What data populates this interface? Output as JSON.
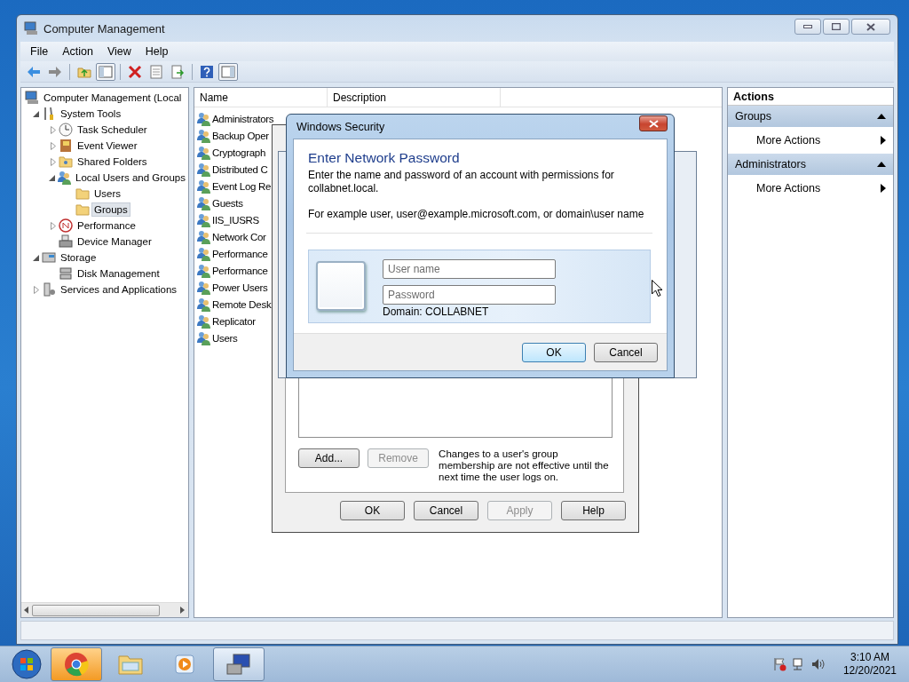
{
  "window": {
    "title": "Computer Management"
  },
  "menu": [
    "File",
    "Action",
    "View",
    "Help"
  ],
  "toolbar": [
    [
      {
        "kind": "back",
        "pressed": false
      },
      {
        "kind": "forward",
        "pressed": false
      }
    ],
    [
      {
        "kind": "up",
        "pressed": false
      },
      {
        "kind": "tree",
        "pressed": true
      }
    ],
    [
      {
        "kind": "delete",
        "pressed": false
      },
      {
        "kind": "properties",
        "pressed": false
      },
      {
        "kind": "export",
        "pressed": false
      }
    ],
    [
      {
        "kind": "help",
        "pressed": false
      },
      {
        "kind": "actionpane",
        "pressed": true
      }
    ]
  ],
  "tree": [
    {
      "label": "Computer Management (Local",
      "kind": "computer",
      "selected": false,
      "children": [
        {
          "label": "System Tools",
          "kind": "tools",
          "expanded": true,
          "selected": false,
          "children": [
            {
              "label": "Task Scheduler",
              "kind": "clock",
              "expanded": false,
              "selected": false
            },
            {
              "label": "Event Viewer",
              "kind": "log",
              "expanded": false,
              "selected": false
            },
            {
              "label": "Shared Folders",
              "kind": "share",
              "expanded": false,
              "selected": false
            },
            {
              "label": "Local Users and Groups",
              "kind": "users",
              "expanded": true,
              "selected": false,
              "children": [
                {
                  "label": "Users",
                  "kind": "folder",
                  "selected": false
                },
                {
                  "label": "Groups",
                  "kind": "folder",
                  "selected": true
                }
              ]
            },
            {
              "label": "Performance",
              "kind": "perf",
              "expanded": false,
              "selected": false
            },
            {
              "label": "Device Manager",
              "kind": "device",
              "selected": false
            }
          ]
        },
        {
          "label": "Storage",
          "kind": "storage",
          "expanded": true,
          "selected": false,
          "children": [
            {
              "label": "Disk Management",
              "kind": "disk",
              "selected": false
            }
          ]
        },
        {
          "label": "Services and Applications",
          "kind": "services",
          "expanded": false,
          "selected": false
        }
      ]
    }
  ],
  "list": {
    "columns": [
      "Name",
      "Description"
    ],
    "rows": [
      {
        "name": "Administrators",
        "selected": false
      },
      {
        "name": "Backup Oper",
        "selected": false
      },
      {
        "name": "Cryptograph",
        "selected": false
      },
      {
        "name": "Distributed C",
        "selected": false
      },
      {
        "name": "Event Log Re",
        "selected": false
      },
      {
        "name": "Guests",
        "selected": false
      },
      {
        "name": "IIS_IUSRS",
        "selected": false
      },
      {
        "name": "Network Cor",
        "selected": false
      },
      {
        "name": "Performance",
        "selected": false
      },
      {
        "name": "Performance",
        "selected": false
      },
      {
        "name": "Power Users",
        "selected": false
      },
      {
        "name": "Remote Desk",
        "selected": false
      },
      {
        "name": "Replicator",
        "selected": false
      },
      {
        "name": "Users",
        "selected": false
      }
    ]
  },
  "actions": {
    "title": "Actions",
    "sections": [
      {
        "title": "Groups",
        "expanded": true,
        "items": [
          "More Actions"
        ]
      },
      {
        "title": "Administrators",
        "expanded": true,
        "items": [
          "More Actions"
        ]
      }
    ]
  },
  "properties_dialog": {
    "note": "Changes to a user's group membership are not effective until the next time the user logs on.",
    "list_buttons": [
      {
        "label": "Add...",
        "disabled": false
      },
      {
        "label": "Remove",
        "disabled": true
      }
    ],
    "buttons": [
      {
        "label": "OK",
        "disabled": false
      },
      {
        "label": "Cancel",
        "disabled": false
      },
      {
        "label": "Apply",
        "disabled": true
      },
      {
        "label": "Help",
        "disabled": false
      }
    ]
  },
  "security_dialog": {
    "title": "Windows Security",
    "heading": "Enter Network Password",
    "message": "Enter the name and password of an account with permissions for collabnet.local.",
    "example": "For example user, user@example.microsoft.com, or domain\\user name",
    "fields": [
      {
        "placeholder": "User name"
      },
      {
        "placeholder": "Password"
      }
    ],
    "domain": "Domain: COLLABNET",
    "buttons": [
      {
        "label": "OK",
        "default": true
      },
      {
        "label": "Cancel",
        "default": false
      }
    ]
  },
  "taskbar": {
    "apps": [
      {
        "kind": "browser",
        "active": false,
        "flashing": true
      },
      {
        "kind": "folder",
        "active": false,
        "flashing": false
      },
      {
        "kind": "media",
        "active": false,
        "flashing": false
      },
      {
        "kind": "computer",
        "active": true,
        "flashing": false
      }
    ],
    "time": "3:10 AM",
    "date": "12/20/2021"
  }
}
